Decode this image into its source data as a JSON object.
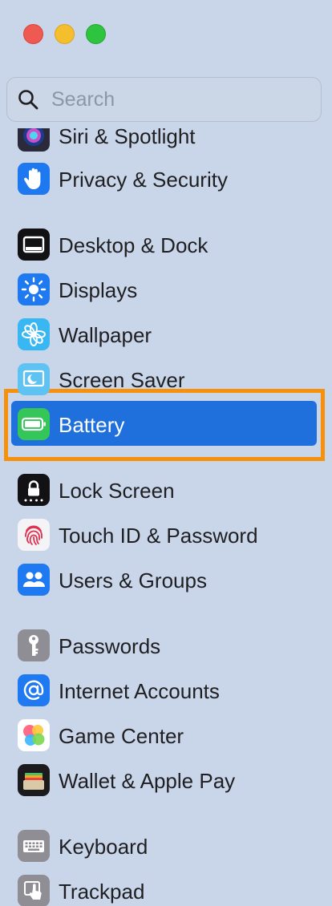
{
  "window": {
    "controls": [
      "close",
      "minimize",
      "zoom"
    ]
  },
  "search": {
    "placeholder": "Search",
    "value": ""
  },
  "sidebar": {
    "selected": "Battery",
    "items": [
      {
        "label": "Siri & Spotlight",
        "icon": "siri-icon"
      },
      {
        "label": "Privacy & Security",
        "icon": "hand-icon"
      },
      {
        "label": "Desktop & Dock",
        "icon": "dock-icon"
      },
      {
        "label": "Displays",
        "icon": "sun-icon"
      },
      {
        "label": "Wallpaper",
        "icon": "flower-icon"
      },
      {
        "label": "Screen Saver",
        "icon": "screen-saver-icon"
      },
      {
        "label": "Battery",
        "icon": "battery-icon"
      },
      {
        "label": "Lock Screen",
        "icon": "lock-icon"
      },
      {
        "label": "Touch ID & Password",
        "icon": "fingerprint-icon"
      },
      {
        "label": "Users & Groups",
        "icon": "users-icon"
      },
      {
        "label": "Passwords",
        "icon": "key-icon"
      },
      {
        "label": "Internet Accounts",
        "icon": "at-icon"
      },
      {
        "label": "Game Center",
        "icon": "game-center-icon"
      },
      {
        "label": "Wallet & Apple Pay",
        "icon": "wallet-icon"
      },
      {
        "label": "Keyboard",
        "icon": "keyboard-icon"
      },
      {
        "label": "Trackpad",
        "icon": "trackpad-icon"
      }
    ]
  },
  "colors": {
    "background": "#c9d6ea",
    "selection": "#1f6fdc",
    "highlight_outline": "#f7900a"
  }
}
